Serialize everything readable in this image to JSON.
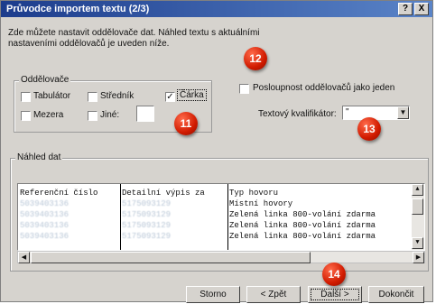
{
  "window": {
    "title": "Průvodce importem textu (2/3)",
    "help_label": "?",
    "close_label": "X"
  },
  "intro": {
    "line1": "Zde můžete nastavit oddělovače dat. Náhled textu s aktuálními",
    "line2": "nastaveními oddělovačů je uveden níže."
  },
  "delimiters": {
    "group_label": "Oddělovače",
    "tab": {
      "label": "Tabulátor",
      "checked": false
    },
    "semicolon": {
      "label": "Středník",
      "checked": false
    },
    "comma": {
      "label": "Čárka",
      "checked": true
    },
    "space": {
      "label": "Mezera",
      "checked": false
    },
    "other": {
      "label": "Jiné:",
      "checked": false,
      "value": ""
    }
  },
  "options": {
    "consecutive_label": "Posloupnost oddělovačů jako jeden",
    "consecutive_checked": false,
    "qualifier_label": "Textový kvalifikátor:",
    "qualifier_value": "\""
  },
  "preview": {
    "group_label": "Náhled dat",
    "columns": [
      {
        "rows": [
          "Referenční číslo",
          "",
          "",
          "",
          ""
        ]
      },
      {
        "rows": [
          "Detailní výpis za",
          "",
          "",
          "",
          ""
        ]
      },
      {
        "rows": [
          "Typ hovoru",
          "Místní hovory",
          "Zelená linka 800-volání zdarma",
          "Zelená linka 800-volání zdarma",
          "Zelená linka 800-volání zdarma"
        ]
      }
    ],
    "blurred_col1": "5039403136",
    "blurred_col2": "5175093129"
  },
  "buttons": {
    "cancel": "Storno",
    "back": "< Zpět",
    "next": "Další >",
    "finish": "Dokončit"
  },
  "callouts": {
    "b11": "11",
    "b12": "12",
    "b13": "13",
    "b14": "14"
  },
  "colors": {
    "titlebar_start": "#1c3c8c",
    "titlebar_end": "#5a84c8",
    "badge": "#d11b00",
    "dialog_bg": "#d6d3ce"
  }
}
